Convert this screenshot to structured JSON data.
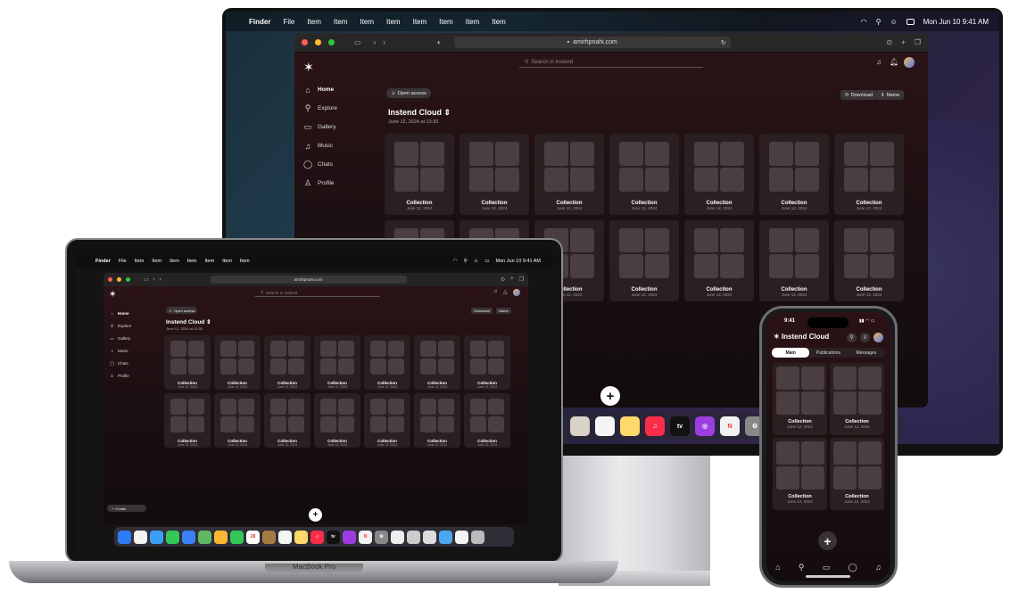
{
  "colors": {
    "app_bg": "#1a0f11",
    "card": "#2a1f21",
    "thumb": "#4a3e40",
    "accent": "#ffffff"
  },
  "menubar": {
    "apple": "",
    "items": [
      "Finder",
      "File",
      "Item",
      "Item",
      "Item",
      "Item",
      "Item",
      "Item",
      "Item",
      "Item",
      "Item"
    ],
    "clock": "Mon Jun 10  9:41 AM",
    "laptop_clock": "Mon Jun 10  9:41 AM"
  },
  "browser": {
    "url": "amirhpnahi.com"
  },
  "app": {
    "search_placeholder": "Search in Instend",
    "open_access": "Open access",
    "title": "Instend Cloud",
    "date": "June 12, 2024 at 13:30",
    "sort_download": "Download",
    "sort_name": "Name",
    "nav": [
      {
        "label": "Home",
        "icon": "home-icon",
        "glyph": "⌂"
      },
      {
        "label": "Explore",
        "icon": "search-icon",
        "glyph": "⚲"
      },
      {
        "label": "Gallery",
        "icon": "gallery-icon",
        "glyph": "▭"
      },
      {
        "label": "Music",
        "icon": "music-icon",
        "glyph": "♫"
      },
      {
        "label": "Chats",
        "icon": "chat-icon",
        "glyph": "◯"
      },
      {
        "label": "Profile",
        "icon": "profile-icon",
        "glyph": "♙"
      }
    ],
    "card_title": "Collection",
    "card_date": "June 12, 2024",
    "fab": "+",
    "create": "Create"
  },
  "laptop": {
    "brand": "MacBook Pro"
  },
  "phone": {
    "time": "9:41",
    "title": "Instend Cloud",
    "tabs": [
      "Main",
      "Publications",
      "Messages"
    ],
    "active_tab": "Main",
    "card_title": "Collection",
    "card_date": "June 12, 2024"
  }
}
